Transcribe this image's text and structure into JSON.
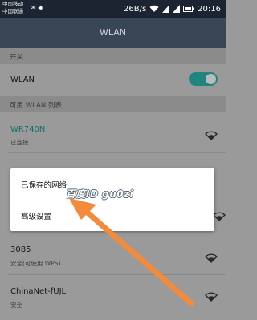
{
  "status_bar": {
    "carrier1": "中国移动",
    "carrier2": "中国联通",
    "net_speed": "26B/s",
    "time": "20:16"
  },
  "app_bar": {
    "title": "WLAN"
  },
  "toggle_section": {
    "header": "开关",
    "wlan_label": "WLAN",
    "wlan_on": true
  },
  "networks_section": {
    "header": "可用 WLAN 列表",
    "networks": [
      {
        "name": "WR740N",
        "status": "已连接",
        "connected": true
      },
      {
        "name": "3085",
        "status": "安全(可使用 WPS)"
      },
      {
        "name": "ChinaNet-fUJL",
        "status": "安全"
      }
    ]
  },
  "menu": {
    "items": [
      "已保存的网络",
      "高级设置"
    ]
  },
  "watermark": "百度ID gu0zi",
  "colors": {
    "accent": "#21857f",
    "app_bar": "#384656",
    "status_bar": "#1c2431",
    "arrow": "#f28c3c"
  }
}
